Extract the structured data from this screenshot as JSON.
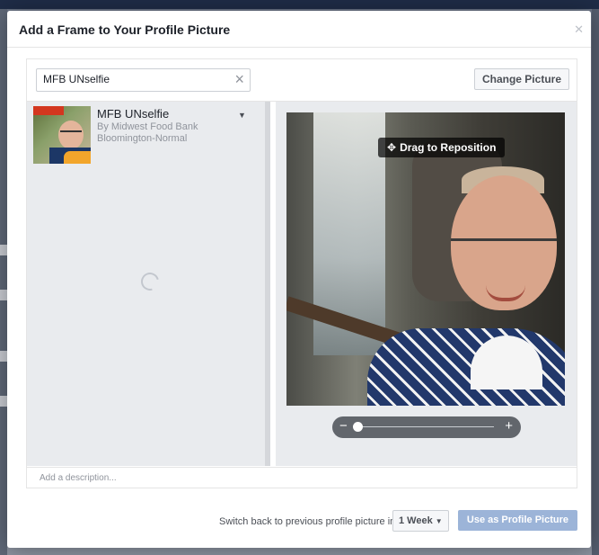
{
  "dialog": {
    "title": "Add a Frame to Your Profile Picture",
    "close_icon": "close-icon"
  },
  "search": {
    "value": "MFB UNselfie",
    "clear_icon": "clear-icon"
  },
  "change_picture_label": "Change Picture",
  "frames": [
    {
      "name": "MFB UNselfie",
      "by": "By Midwest Food Bank",
      "location": "Bloomington-Normal",
      "menu_icon": "caret-down-icon"
    }
  ],
  "preview": {
    "drag_label": "Drag to Reposition",
    "drag_icon": "move-icon",
    "zoom": {
      "minus": "−",
      "plus": "+",
      "level": 0.0
    }
  },
  "description_placeholder": "Add a description...",
  "footer": {
    "switch_back_label": "Switch back to previous profile picture in",
    "duration_value": "1 Week",
    "use_button_label": "Use as Profile Picture"
  },
  "colors": {
    "primary_disabled": "#9cb4d8",
    "pane_bg": "#e9ebee"
  }
}
